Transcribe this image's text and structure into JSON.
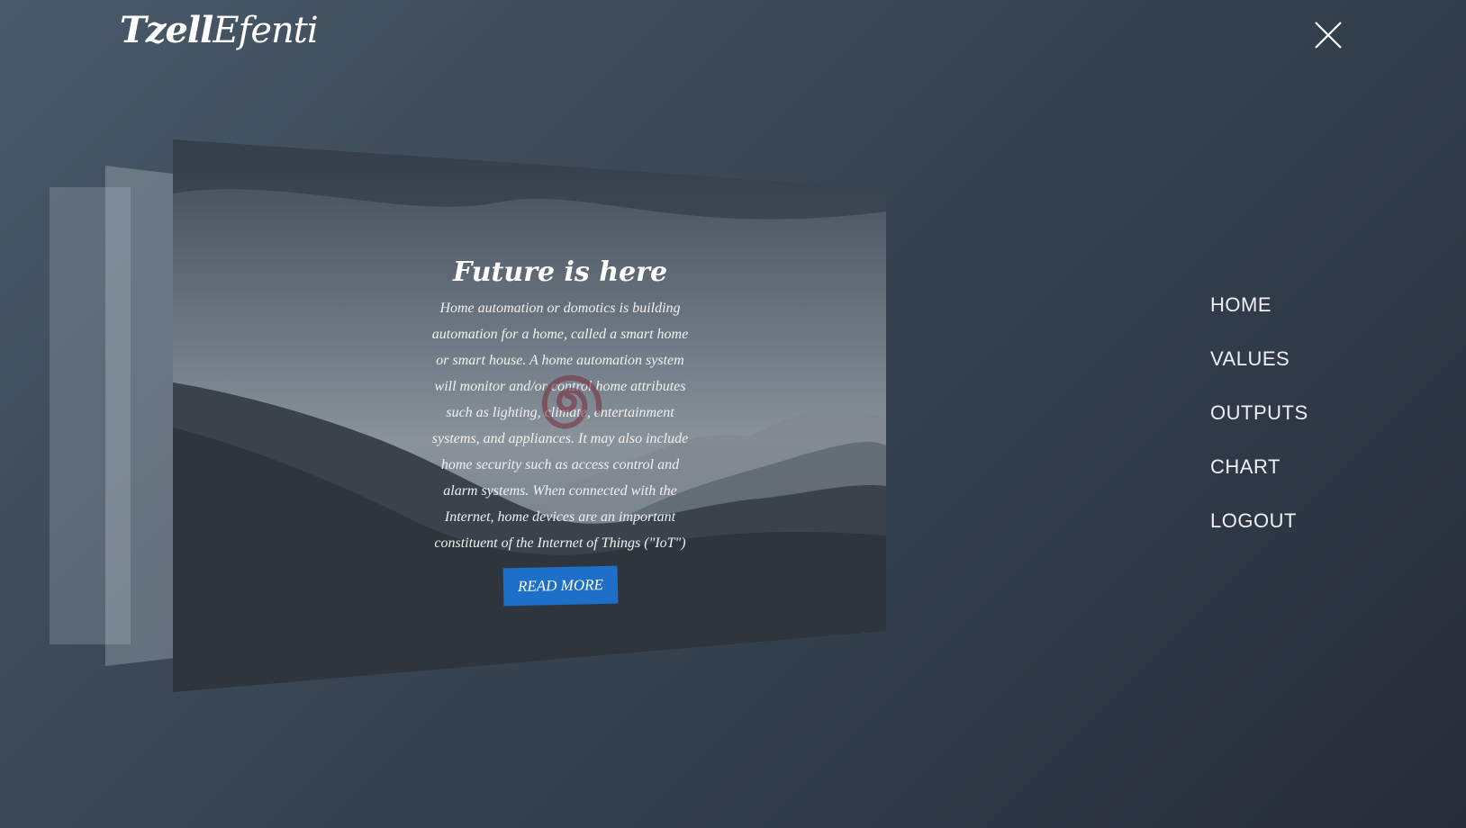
{
  "brand": {
    "name_bold": "Tzell",
    "name_light": "Efenti"
  },
  "hero": {
    "title": "Future is here",
    "body": "Home automation or domotics is building automation for a home, called a smart home or smart house. A home automation system will monitor and/or control home attributes such as lighting, climate, entertainment systems, and appliances. It may also include home security such as access control and alarm systems. When connected with the Internet, home devices are an important constituent of the Internet of Things (\"IoT\")",
    "cta_label": "READ MORE"
  },
  "nav": {
    "items": [
      {
        "label": "HOME"
      },
      {
        "label": "VALUES"
      },
      {
        "label": "OUTPUTS"
      },
      {
        "label": "CHART"
      },
      {
        "label": "LOGOUT"
      }
    ]
  },
  "colors": {
    "accent": "#1e6fc7",
    "background_start": "#4a5a68",
    "background_end": "#262d3a",
    "spiral": "#7a2a3a"
  },
  "icons": {
    "close": "close-icon",
    "spiral": "spiral-logo"
  }
}
